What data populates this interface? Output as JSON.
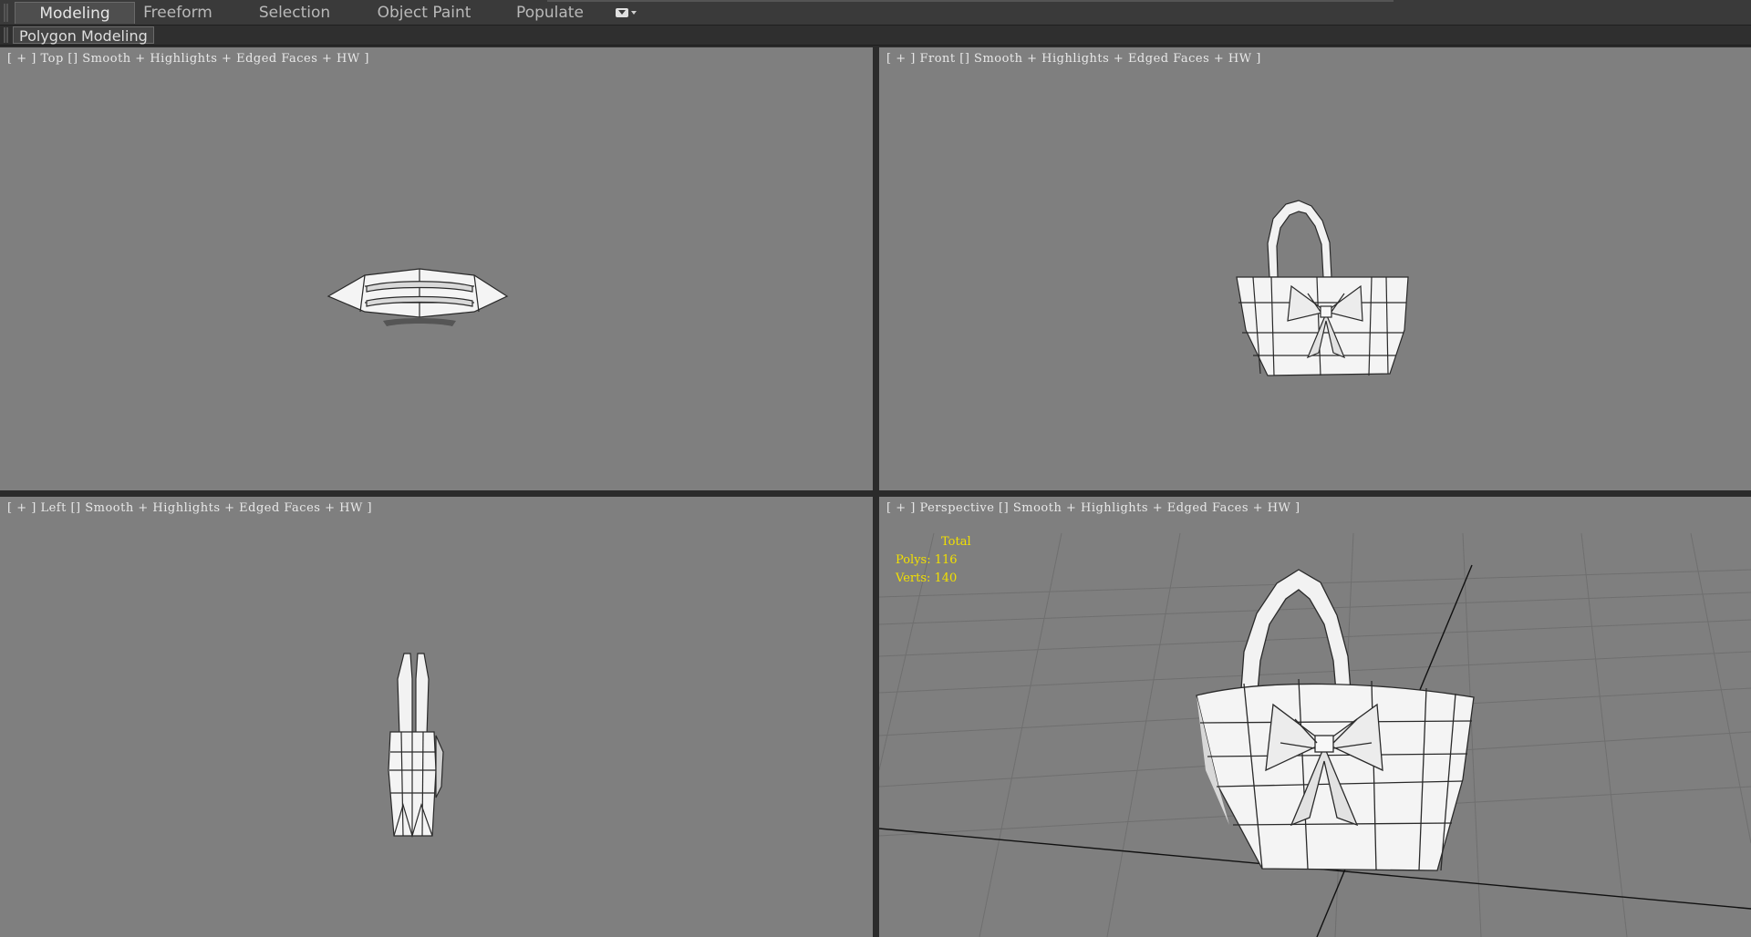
{
  "ribbon": {
    "tabs": [
      {
        "label": "Modeling",
        "active": true
      },
      {
        "label": "Freeform",
        "active": false
      },
      {
        "label": "Selection",
        "active": false
      },
      {
        "label": "Object Paint",
        "active": false
      },
      {
        "label": "Populate",
        "active": false
      }
    ],
    "more_icon": "dropdown-toggle-icon"
  },
  "subribbon": {
    "panel_label": "Polygon Modeling"
  },
  "viewports": {
    "top": {
      "plus": "[ + ]",
      "view": "Top",
      "shading": "Smooth + Highlights + Edged Faces + HW ]"
    },
    "front": {
      "plus": "[ + ]",
      "view": "Front",
      "shading": "Smooth + Highlights + Edged Faces + HW ]"
    },
    "left": {
      "plus": "[ + ]",
      "view": "Left",
      "shading": "Smooth + Highlights + Edged Faces + HW ]"
    },
    "perspective": {
      "plus": "[ + ]",
      "view": "Perspective",
      "shading": "Smooth + Highlights + Edged Faces + HW ]"
    }
  },
  "stats": {
    "title": "Total",
    "polys": "Polys: 116",
    "verts": "Verts: 140"
  },
  "colors": {
    "viewport_bg": "#7f7f7f",
    "stats_text": "#f2e000",
    "label_text": "#e8e8e8"
  }
}
